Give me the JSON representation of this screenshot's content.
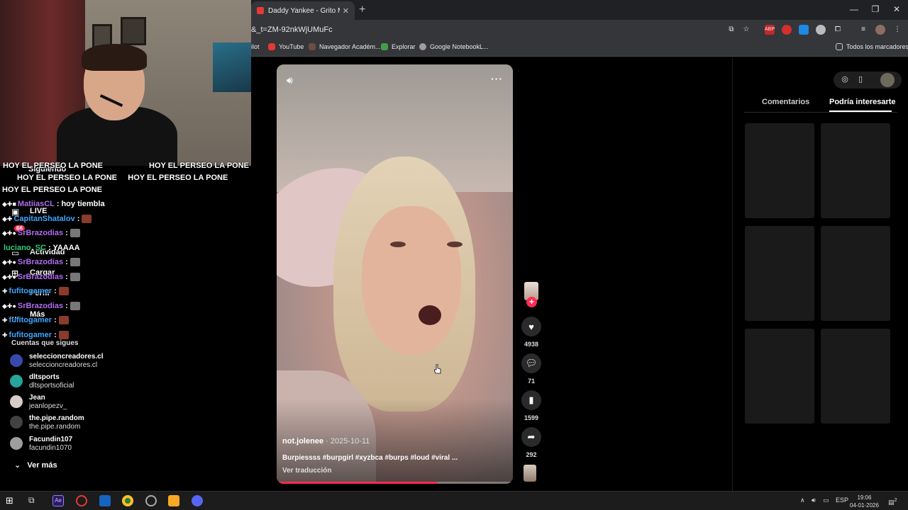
{
  "browser": {
    "tab_title": "Daddy Yankee - Grito Mundial",
    "url": "&_t=ZM-92nkWjUMuFc",
    "bookmarks": [
      {
        "label": "ilot",
        "color": "#35363a"
      },
      {
        "label": "YouTube",
        "color": "#e53935"
      },
      {
        "label": "Navegador Académ...",
        "color": "#6d4c41"
      },
      {
        "label": "Explorar",
        "color": "#43a047"
      },
      {
        "label": "Google NotebookL...",
        "color": "#9e9e9e"
      }
    ],
    "all_bookmarks": "Todos los marcadores"
  },
  "sidebar": {
    "items": [
      "Siguiendo",
      "LIVE",
      "Actividad",
      "Cargar",
      "Perfil",
      "Más"
    ],
    "following_header": "Cuentas que sigues",
    "accounts": [
      {
        "name": "seleccioncreadores.cl",
        "handle": "seleccioncreadores.cl"
      },
      {
        "name": "dltsports",
        "handle": "dltsportsoficial"
      },
      {
        "name": "Jean",
        "handle": "jeanlopezv_"
      },
      {
        "name": "the.pipe.random",
        "handle": "the.pipe.random"
      },
      {
        "name": "Facundin107",
        "handle": "facundin1070"
      }
    ],
    "see_more": "Ver más"
  },
  "chat": [
    {
      "user": "",
      "text": "HOY EL PERSEO LA PONE",
      "color": "#ffffff"
    },
    {
      "user": "MatiiasCL",
      "text": ": hoy tiembla",
      "color": "#b16cf2"
    },
    {
      "user": "CapitanShatalov",
      "text": ":",
      "color": "#3ea6ff"
    },
    {
      "user": "SrBrazodias",
      "text": ":",
      "color": "#b16cf2"
    },
    {
      "user": "luciano_SC",
      "text": ": YAAAA",
      "color": "#2ecc71"
    },
    {
      "user": "SrBrazodias",
      "text": ":",
      "color": "#b16cf2"
    },
    {
      "user": "SrBrazodias",
      "text": ":",
      "color": "#b16cf2"
    },
    {
      "user": "fufitogamer",
      "text": ":",
      "color": "#3ea6ff"
    },
    {
      "user": "SrBrazodias",
      "text": ":",
      "color": "#b16cf2"
    },
    {
      "user": "fufitogamer",
      "text": ":",
      "color": "#3ea6ff"
    },
    {
      "user": "fufitogamer",
      "text": ":",
      "color": "#3ea6ff"
    }
  ],
  "chat_banner": {
    "line1": "HOY EL PERSEO LA PONE",
    "line2": "HOY EL PERSEO LA PONE",
    "line3": "HOY EL PERSEO LA PONE",
    "line4": "HOY EL PERSEO LA PONE"
  },
  "video": {
    "author": "not.jolenee",
    "date": " · 2025-10-11",
    "description": "Burpiessss #burpgirl #xyzbca #burps #loud #viral ...",
    "translate": "Ver traducción",
    "progress": 0.68,
    "likes": "4938",
    "comments": "71",
    "saves": "1599",
    "shares": "292",
    "badge_count": "66"
  },
  "right_panel": {
    "tab_comments": "Comentarios",
    "tab_suggestions": "Podría interesarte"
  },
  "taskbar": {
    "lang": "ESP",
    "time": "19:06",
    "date": "04-01-2026",
    "notifications": "2"
  }
}
